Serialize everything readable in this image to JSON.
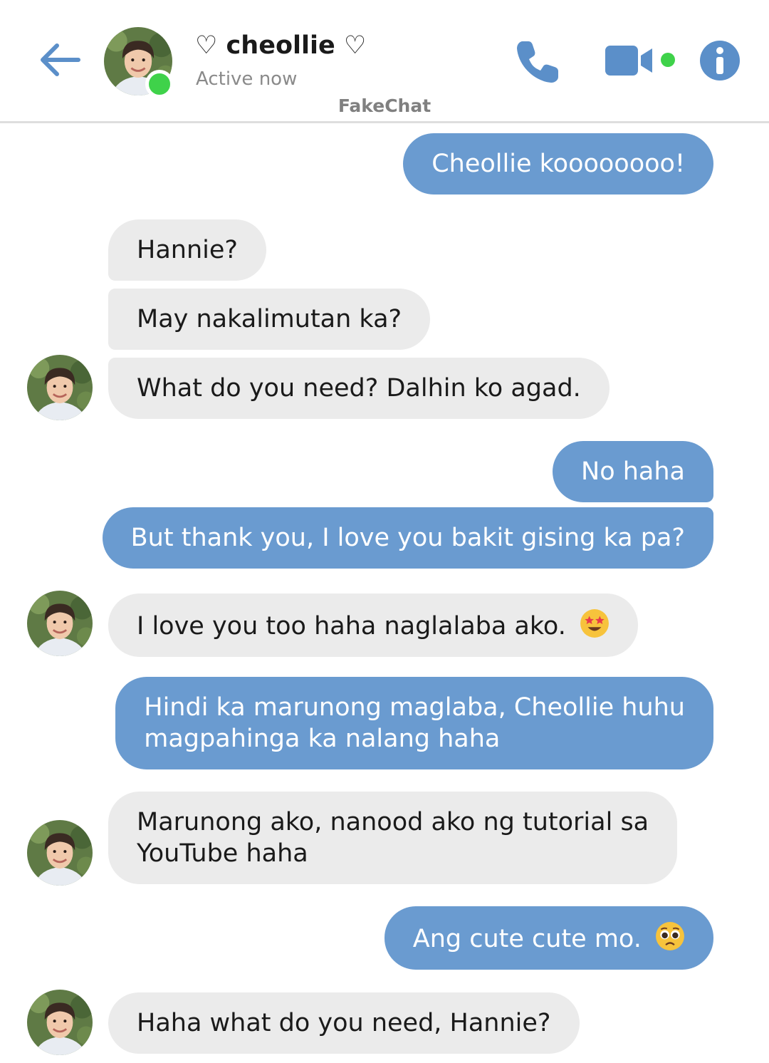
{
  "header": {
    "contact_name": "♡ cheollie ♡",
    "status": "Active now",
    "brand": "FakeChat"
  },
  "colors": {
    "accent": "#5b8fc9",
    "outgoing_bubble": "#6a9bd0",
    "incoming_bubble": "#ebebeb",
    "online": "#3fd24a"
  },
  "icons": {
    "back": "arrow-left",
    "call": "phone",
    "video": "video-camera",
    "info": "info-circle"
  },
  "messages": [
    {
      "side": "out",
      "text": "Cheollie koooooooo!"
    },
    {
      "side": "in",
      "text": "Hannie?"
    },
    {
      "side": "in",
      "text": "May nakalimutan ka?"
    },
    {
      "side": "in",
      "text": "What do you need? Dalhin ko agad."
    },
    {
      "side": "out",
      "text": "No haha"
    },
    {
      "side": "out",
      "text": "But thank you, I love you bakit gising ka pa?"
    },
    {
      "side": "in",
      "text": "I love you too haha naglalaba ako.",
      "emoji": "star-struck"
    },
    {
      "side": "out",
      "text": "Hindi ka marunong maglaba, Cheollie huhu\nmagpahinga ka nalang haha"
    },
    {
      "side": "in",
      "text": "Marunong ako, nanood ako ng tutorial sa\nYouTube haha"
    },
    {
      "side": "out",
      "text": "Ang cute cute mo.",
      "emoji": "pleading-face"
    },
    {
      "side": "in",
      "text": "Haha what do you need, Hannie?"
    }
  ]
}
